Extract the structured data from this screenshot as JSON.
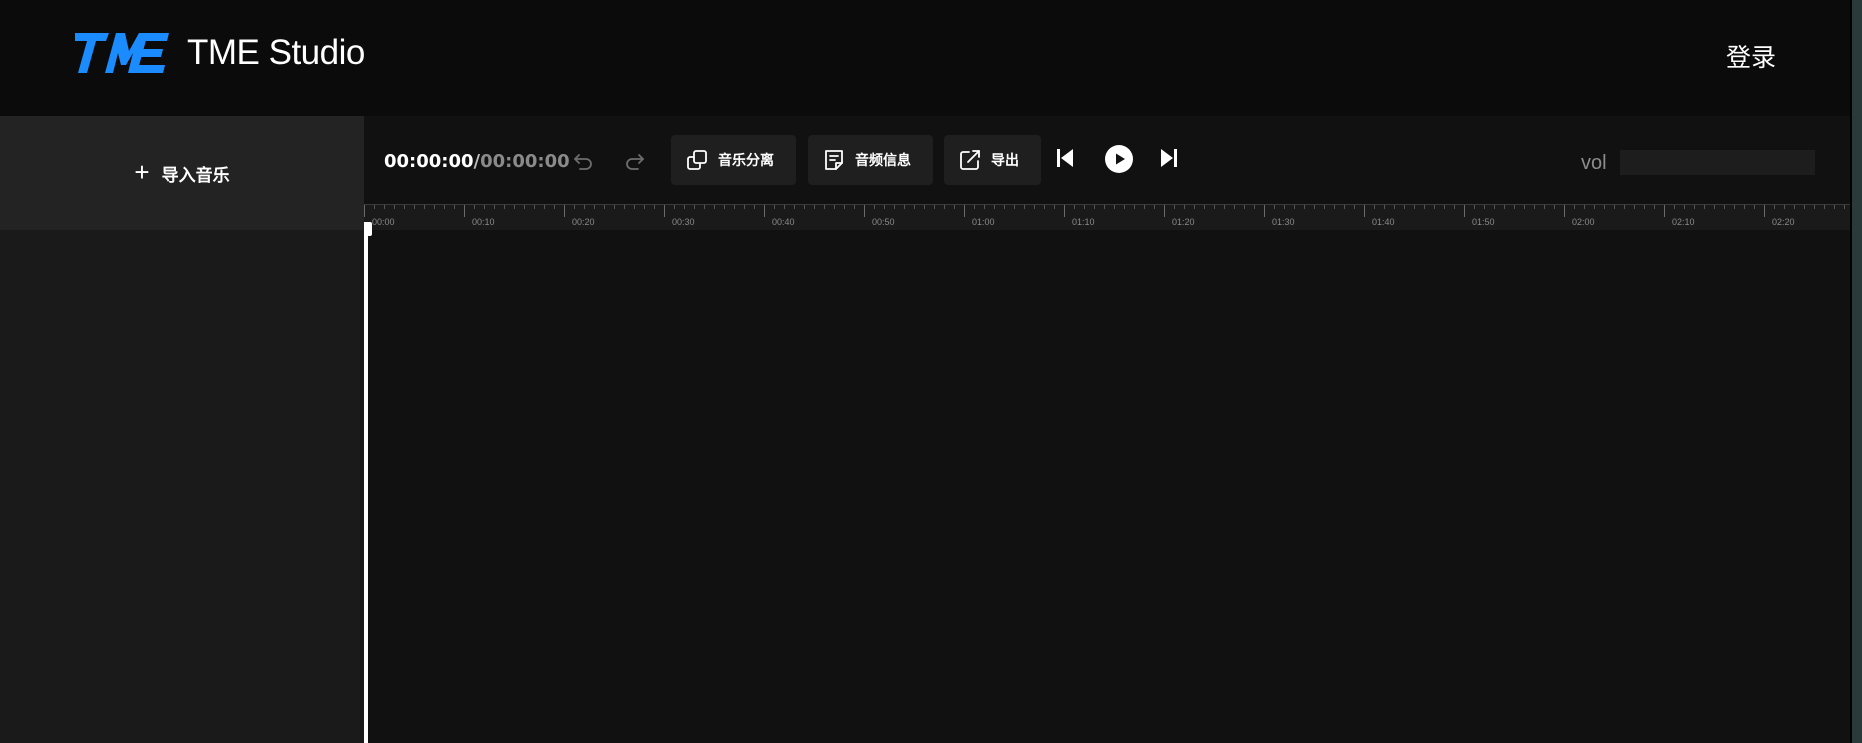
{
  "header": {
    "app_name": "TME Studio",
    "login_label": "登录",
    "brand_color": "#1a8cff"
  },
  "sidebar": {
    "import_label": "导入音乐",
    "import_icon": "plus-icon"
  },
  "toolbar": {
    "time_current": "00:00:00",
    "time_separator": "/",
    "time_total": "00:00:00",
    "undo_icon": "undo-icon",
    "redo_icon": "redo-icon",
    "buttons": [
      {
        "label": "音乐分离",
        "icon": "copy-layers-icon"
      },
      {
        "label": "音频信息",
        "icon": "document-icon"
      },
      {
        "label": "导出",
        "icon": "share-export-icon"
      }
    ],
    "transport": {
      "prev_icon": "skip-previous-icon",
      "play_icon": "play-icon",
      "next_icon": "skip-next-icon"
    },
    "volume_label": "vol"
  },
  "timeline": {
    "ticks": [
      "00:00",
      "00:10",
      "00:20",
      "00:30",
      "00:40",
      "00:50",
      "01:00",
      "01:10",
      "01:20",
      "01:30",
      "01:40",
      "01:50",
      "02:00",
      "02:10",
      "02:20"
    ],
    "playhead_time": "00:00"
  }
}
